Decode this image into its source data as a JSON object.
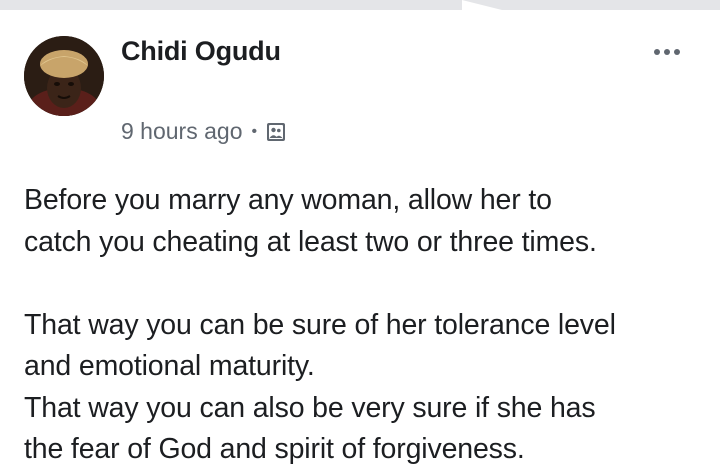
{
  "post": {
    "author": {
      "name": "Chidi Ogudu",
      "avatar_icon": "profile-photo"
    },
    "meta": {
      "timestamp": "9 hours ago",
      "separator": "•",
      "audience_icon": "friends-audience-icon"
    },
    "menu_icon": "more-options-icon",
    "body": {
      "lines": [
        "Before you marry any woman, allow her to",
        "catch you cheating at least two or three times.",
        "",
        "That way you can be sure of her tolerance level",
        "and emotional maturity.",
        "That way you can also be very sure if she has",
        "the fear of God and spirit of forgiveness."
      ]
    }
  },
  "colors": {
    "text_primary": "#1c1e21",
    "text_secondary": "#606770",
    "background": "#ffffff",
    "top_strip": "#e4e5e8"
  }
}
